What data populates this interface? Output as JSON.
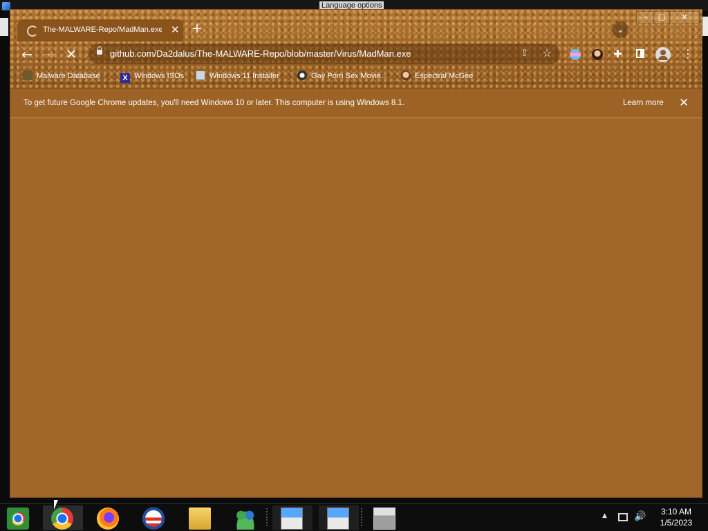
{
  "desktop": {
    "language_label": "Language options"
  },
  "window": {
    "caption_min": "–",
    "caption_max": "□",
    "caption_close": "✕"
  },
  "tab": {
    "title": "The-MALWARE-Repo/MadMan.exe",
    "close_glyph": "✕",
    "new_tab_glyph": "+",
    "search_glyph": "⌄",
    "loading": true
  },
  "toolbar": {
    "back_glyph": "←",
    "forward_glyph": "→",
    "stop_glyph": "✕",
    "url": "github.com/Da2dalus/The-MALWARE-Repo/blob/master/Virus/MadMan.exe",
    "share_glyph": "⇪",
    "star_glyph": "☆",
    "puzzle_glyph": "✚",
    "menu_glyph": "⋮"
  },
  "bookmarks": [
    {
      "label": "Malware Database",
      "icon": "malware-db-icon"
    },
    {
      "label": "Windows ISOs",
      "icon": "x-logo-icon"
    },
    {
      "label": "Windows 11 Installer",
      "icon": "installer-icon"
    },
    {
      "label": "Gay Porn Sex Movie...",
      "icon": "site-icon"
    },
    {
      "label": "Espectral McGee",
      "icon": "avatar-icon"
    }
  ],
  "infobar": {
    "message": "To get future Google Chrome updates, you'll need Windows 10 or later. This computer is using Windows 8.1.",
    "learn_more": "Learn more",
    "close_glyph": "✕"
  },
  "taskbar": {
    "items": [
      "start",
      "chrome",
      "firefox",
      "obama",
      "file-explorer",
      "people",
      "setup-1",
      "setup-2",
      "archive"
    ],
    "tray_chevron": "▲",
    "volume_glyph": "🔊",
    "time": "3:10 AM",
    "date": "1/5/2023"
  },
  "colors": {
    "theme": "#a0662a",
    "taskbar": "#0d0d0d"
  }
}
